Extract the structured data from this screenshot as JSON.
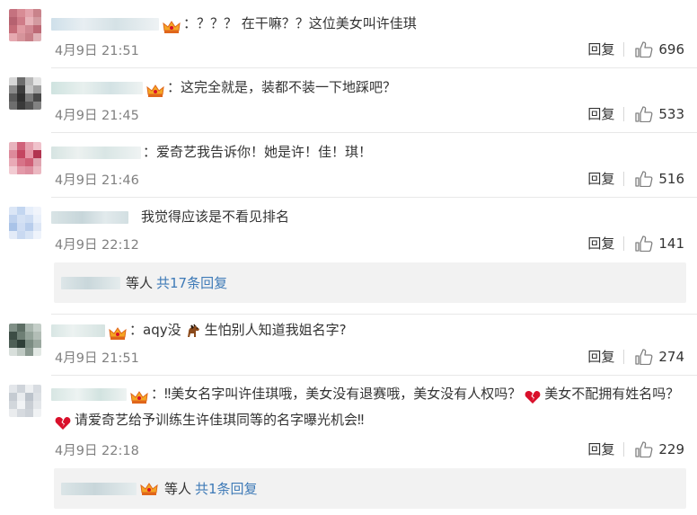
{
  "comments": [
    {
      "text": "：？？？ 在干嘛？？这位美女叫许佳琪",
      "date": "4月9日 21:51",
      "reply_label": "回复",
      "likes": "696"
    },
    {
      "text": "：这完全就是，装都不装一下地踩吧？",
      "date": "4月9日 21:45",
      "reply_label": "回复",
      "likes": "533"
    },
    {
      "text": "：爱奇艺我告诉你！她是许！佳！琪！",
      "date": "4月9日 21:46",
      "reply_label": "回复",
      "likes": "516"
    },
    {
      "text": "我觉得应该是不看见排名",
      "date": "4月9日 22:12",
      "reply_label": "回复",
      "likes": "141",
      "more": {
        "suffix": "等人",
        "count_label": "共17条回复"
      }
    },
    {
      "text_before": "：aqy没",
      "text_after": "生怕别人知道我姐名字?",
      "date": "4月9日 21:51",
      "reply_label": "回复",
      "likes": "274"
    },
    {
      "text_part1": "：‼美女名字叫许佳琪哦，美女没有退赛哦，美女没有人权吗？",
      "text_part2": "美女不配拥有姓名吗？",
      "text_part3": "请爱奇艺给予训练生许佳琪同等的名字曝光机会‼",
      "date": "4月9日 22:18",
      "reply_label": "回复",
      "likes": "229",
      "more": {
        "suffix": "等人",
        "count_label": "共1条回复"
      }
    }
  ],
  "colors": {
    "link": "#3e7ab7",
    "meta": "#808080",
    "reply_box": "#f2f2f2",
    "heart": "#d9102b"
  },
  "icons": {
    "like": "thumbs-up-icon",
    "crown": "crown-badge-icon",
    "heart": "broken-heart-icon",
    "horse": "horse-emoji-icon"
  }
}
